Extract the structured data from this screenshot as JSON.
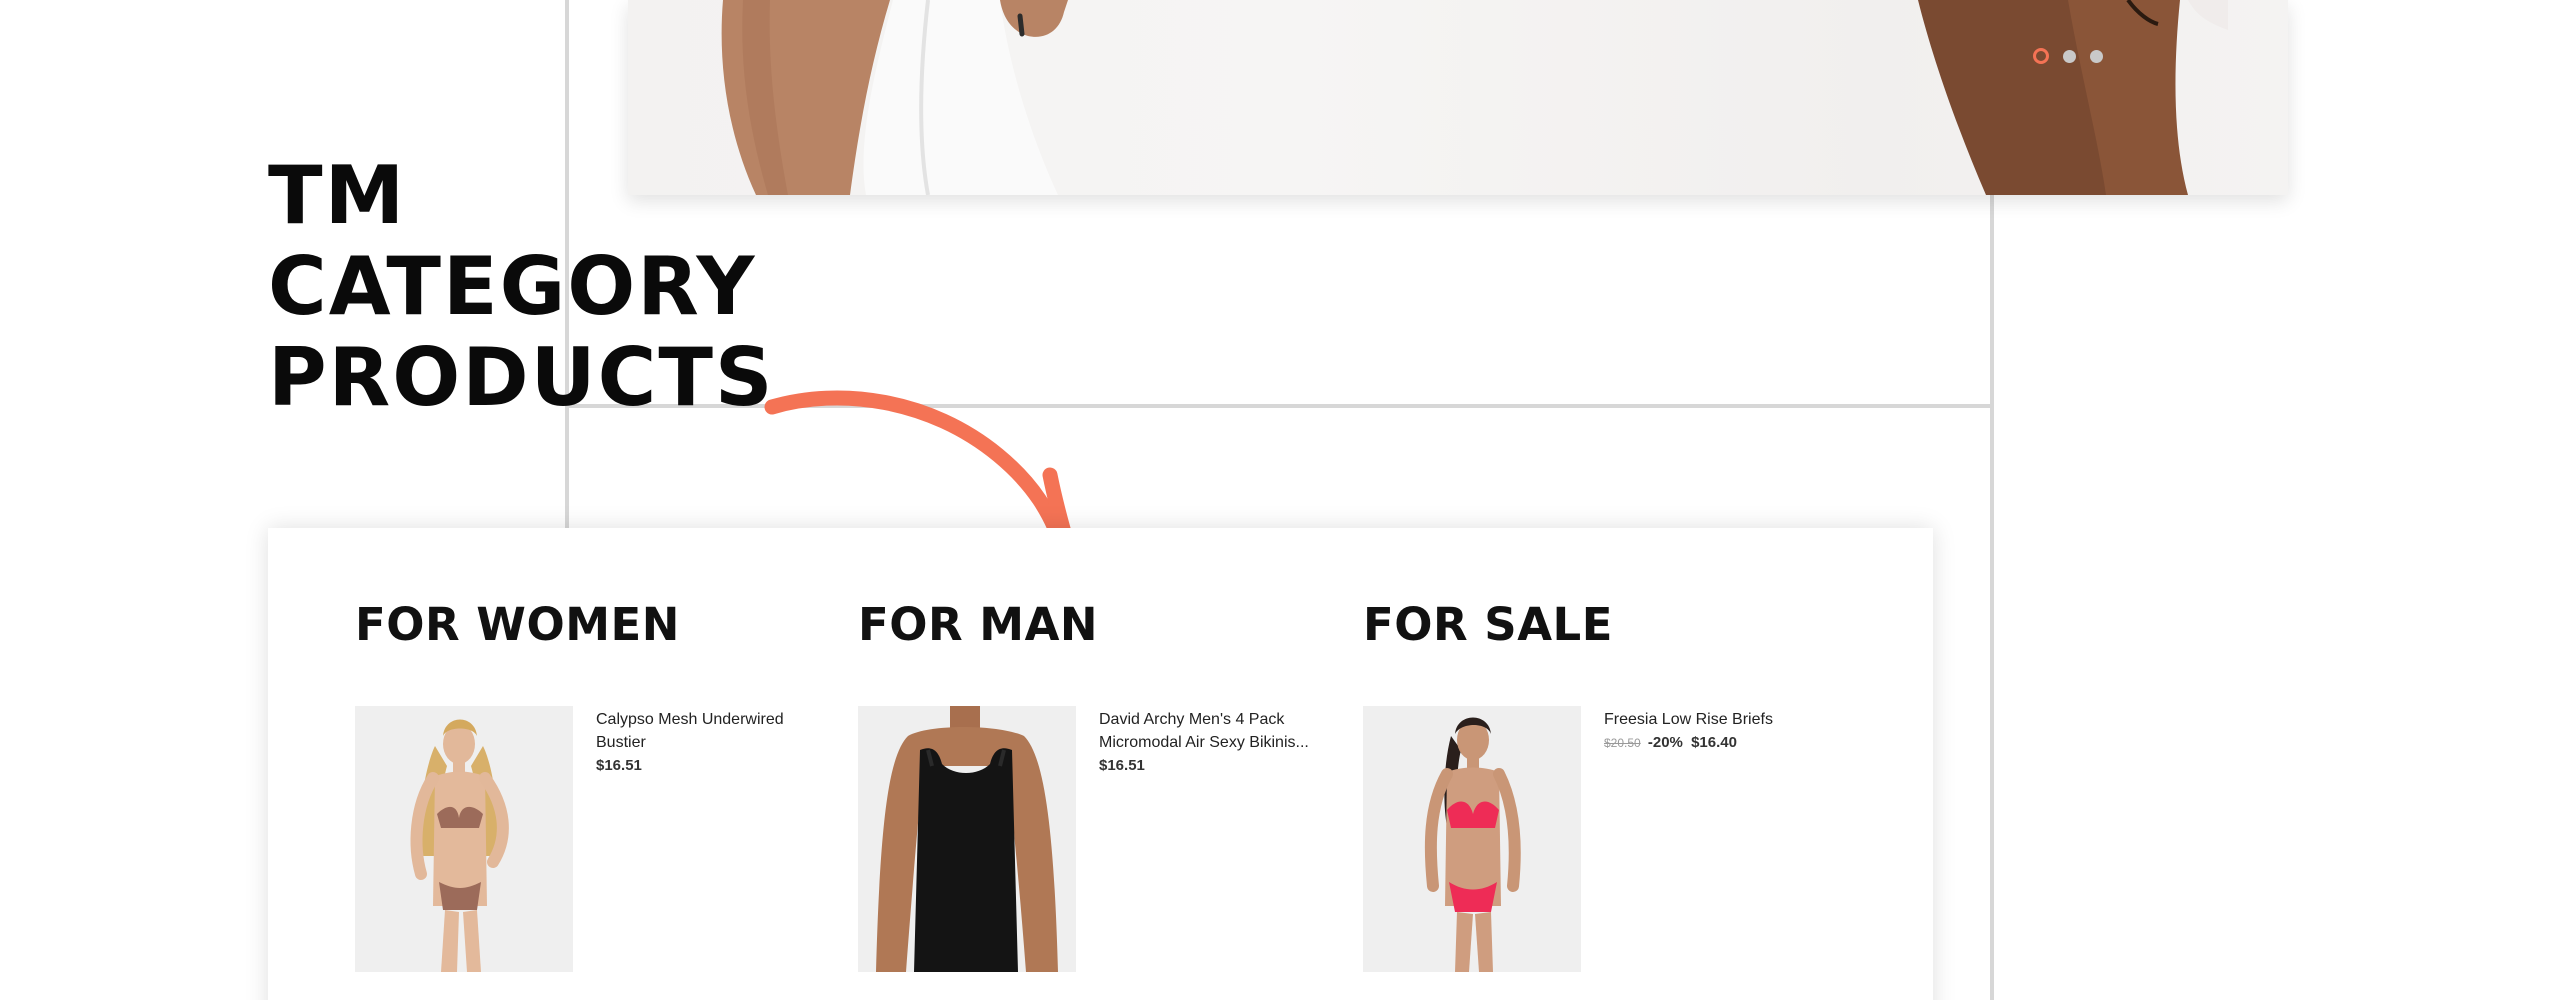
{
  "module": {
    "title_lines": [
      "TM",
      "CATEGORY",
      "PRODUCTS"
    ]
  },
  "slider": {
    "dots": [
      "slide-1",
      "slide-2",
      "slide-3"
    ],
    "active_index": 0
  },
  "colors": {
    "accent": "#f47355",
    "heading": "#111111",
    "guide": "#d7d7d7"
  },
  "categories": [
    {
      "title": "FOR WOMEN",
      "product": {
        "name": "Calypso Mesh Underwired Bustier",
        "price": "$16.51"
      }
    },
    {
      "title": "FOR MAN",
      "product": {
        "name": "David Archy Men's 4 Pack Micromodal Air Sexy Bikinis...",
        "price": "$16.51"
      }
    },
    {
      "title": "FOR SALE",
      "product": {
        "name": "Freesia Low Rise Briefs",
        "old_price": "$20.50",
        "discount": "-20%",
        "price": "$16.40"
      }
    }
  ]
}
